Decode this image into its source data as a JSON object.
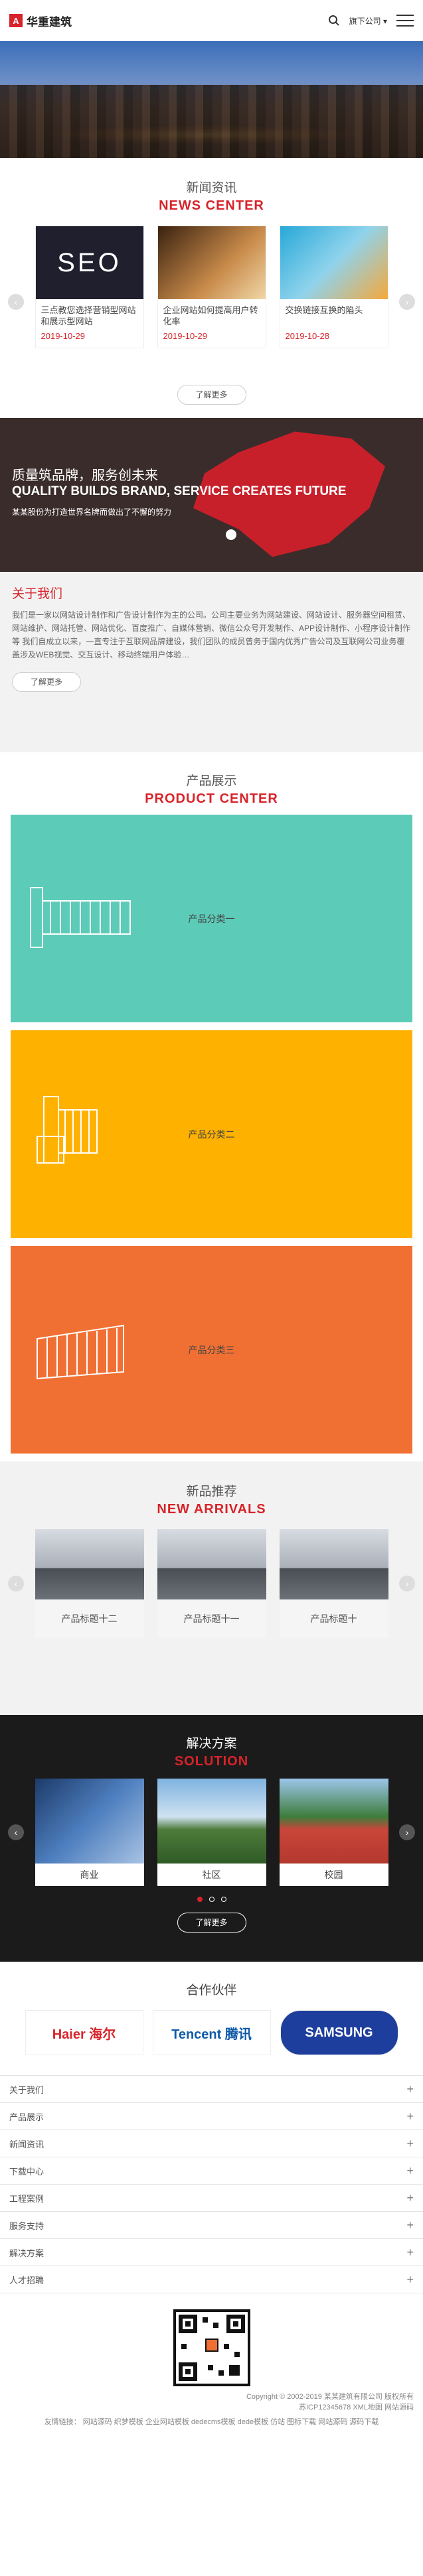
{
  "header": {
    "logo_mark": "A",
    "logo_text": "华重建筑",
    "subsidiary_label": "旗下公司 ▾"
  },
  "news": {
    "title_cn": "新闻资讯",
    "title_en": "NEWS CENTER",
    "items": [
      {
        "title": "三点教您选择营销型网站和展示型网站",
        "date": "2019-10-29",
        "img_text": "SEO"
      },
      {
        "title": "企业网站如何提高用户转化率",
        "date": "2019-10-29",
        "img_text": ""
      },
      {
        "title": "交换链接互换的陷头",
        "date": "2019-10-28",
        "img_text": ""
      }
    ],
    "more_label": "了解更多"
  },
  "banner": {
    "cn": "质量筑品牌，服务创未来",
    "en": "QUALITY BUILDS BRAND, SERVICE CREATES FUTURE",
    "sub": "某某股份为打造世界名牌而做出了不懈的努力"
  },
  "about": {
    "title": "关于我们",
    "body": "我们是一家以网站设计制作和广告设计制作为主的公司。公司主要业务为网站建设、网站设计、服务器空间租赁、网站维护、网站托管、网站优化、百度推广、自媒体营销、微信公众号开发制作、APP设计制作、小程序设计制作等 我们自成立以来，一直专注于互联网品牌建设，我们团队的成员曾务于国内优秀广告公司及互联网公司业务覆盖涉及WEB视觉、交互设计、移动终端用户体验…",
    "more_label": "了解更多"
  },
  "products": {
    "title_cn": "产品展示",
    "title_en": "PRODUCT CENTER",
    "items": [
      {
        "label": "产品分类一",
        "color": "#5ccbb8"
      },
      {
        "label": "产品分类二",
        "color": "#ffb100"
      },
      {
        "label": "产品分类三",
        "color": "#f07034"
      }
    ]
  },
  "arrivals": {
    "title_cn": "新品推荐",
    "title_en": "NEW ARRIVALS",
    "items": [
      {
        "label": "产品标题十二"
      },
      {
        "label": "产品标题十一"
      },
      {
        "label": "产品标题十"
      }
    ]
  },
  "solution": {
    "title_cn": "解决方案",
    "title_en": "SOLUTION",
    "items": [
      {
        "label": "商业"
      },
      {
        "label": "社区"
      },
      {
        "label": "校园"
      }
    ],
    "more_label": "了解更多"
  },
  "partners": {
    "title": "合作伙伴",
    "items": [
      {
        "name": "Haier 海尔",
        "color": "#d8232a"
      },
      {
        "name": "Tencent 腾讯",
        "color": "#0f5aa8"
      },
      {
        "name": "SAMSUNG",
        "color": "#1d3e9c"
      }
    ]
  },
  "footer_nav": [
    {
      "label": "关于我们"
    },
    {
      "label": "产品展示"
    },
    {
      "label": "新闻资讯"
    },
    {
      "label": "下载中心"
    },
    {
      "label": "工程案例"
    },
    {
      "label": "服务支持"
    },
    {
      "label": "解决方案"
    },
    {
      "label": "人才招聘"
    }
  ],
  "copyright": {
    "line1": "Copyright © 2002-2019 某某建筑有限公司 版权所有",
    "line2": "苏ICP12345678 XML地图 网站源码",
    "links": "友情链接： 网站源码 织梦模板 企业网站模板 dedecms模板 dede模板 仿站 图标下载 网站源码 源码下载"
  }
}
